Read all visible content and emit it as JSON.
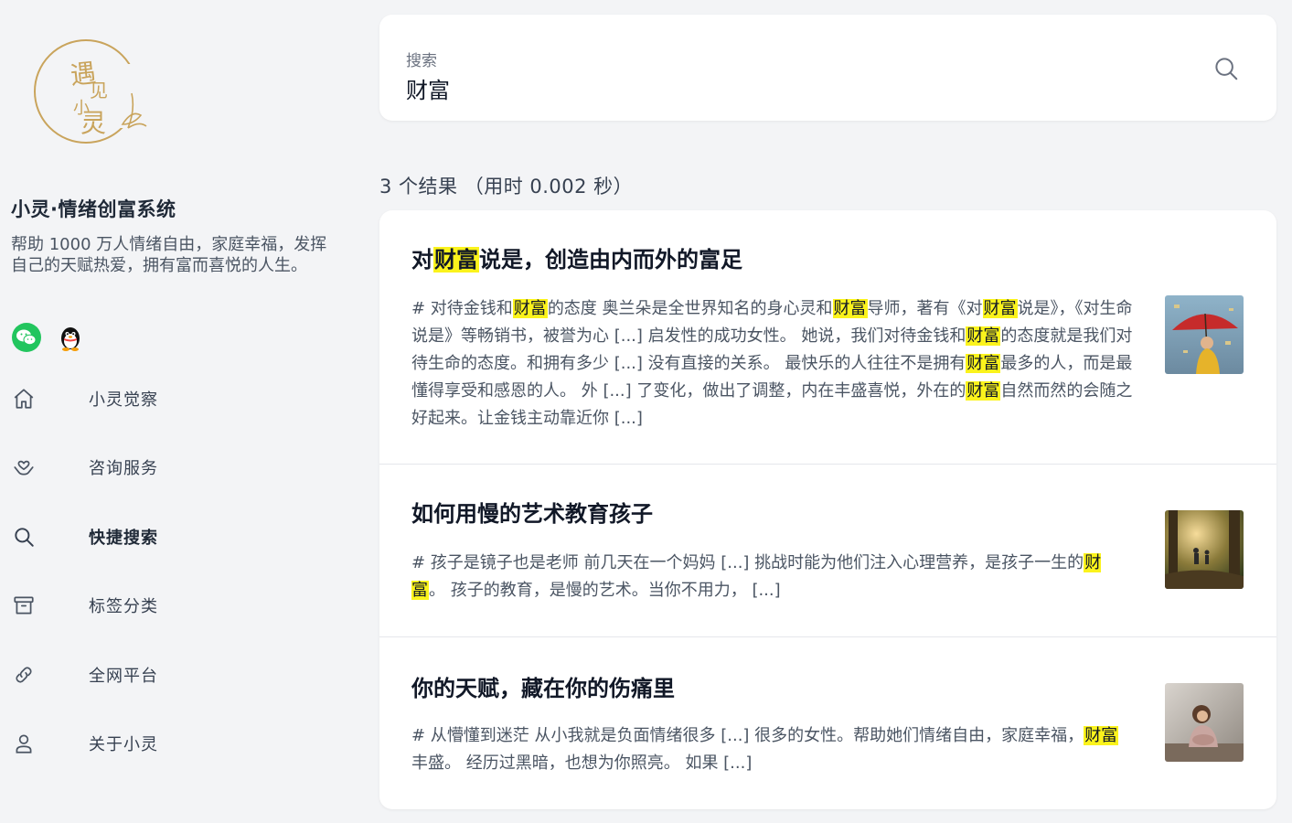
{
  "site": {
    "title": "小灵·情绪创富系统",
    "description": "帮助 1000 万人情绪自由，家庭幸福，发挥自己的天赋热爱，拥有富而喜悦的人生。",
    "logo_text": "遇见小灵"
  },
  "nav": [
    {
      "label": "小灵觉察",
      "icon": "home-icon"
    },
    {
      "label": "咨询服务",
      "icon": "heart-hand-icon"
    },
    {
      "label": "快捷搜索",
      "icon": "search-icon",
      "active": true
    },
    {
      "label": "标签分类",
      "icon": "archive-icon"
    },
    {
      "label": "全网平台",
      "icon": "link-icon"
    },
    {
      "label": "关于小灵",
      "icon": "user-icon"
    }
  ],
  "search": {
    "label": "搜索",
    "value": "财富"
  },
  "result_count": "3 个结果 （用时 0.002 秒）",
  "results": [
    {
      "title_parts": [
        "对",
        "财富",
        "说是，创造由内而外的富足"
      ],
      "snippet_parts": [
        "# 对待金钱和",
        "财富",
        "的态度 奥兰朵是全世界知名的身心灵和",
        "财富",
        "导师，著有《对",
        "财富",
        "说是》，《对生命说是》等畅销书，被誉为心 [...] 启发性的成功女性。 她说，我们对待金钱和",
        "财富",
        "的态度就是我们对待生命的态度。和拥有多少 [...] 没有直接的关系。 最快乐的人往往不是拥有",
        "财富",
        "最多的人，而是最懂得享受和感恩的人。 外 [...] 了变化，做出了调整，内在丰盛喜悦，外在的",
        "财富",
        "自然而然的会随之好起来。让金钱主动靠近你 [...]"
      ]
    },
    {
      "title_parts": [
        "如何用慢的艺术教育孩子"
      ],
      "snippet_parts": [
        "# 孩子是镜子也是老师 前几天在一个妈妈 [...] 挑战时能为他们注入心理营养，是孩子一生的",
        "财富",
        "。 孩子的教育，是慢的艺术。当你不用力， [...]"
      ]
    },
    {
      "title_parts": [
        "你的天赋，藏在你的伤痛里"
      ],
      "snippet_parts": [
        "# 从懵懂到迷茫 从小我就是负面情绪很多 [...] 很多的女性。帮助她们情绪自由，家庭幸福，",
        "财富",
        "丰盛。 经历过黑暗，也想为你照亮。 如果 [...]"
      ]
    }
  ],
  "colors": {
    "highlight": "#fbf31c",
    "background": "#f3f4f6",
    "logo_gold": "#c9a45c"
  }
}
